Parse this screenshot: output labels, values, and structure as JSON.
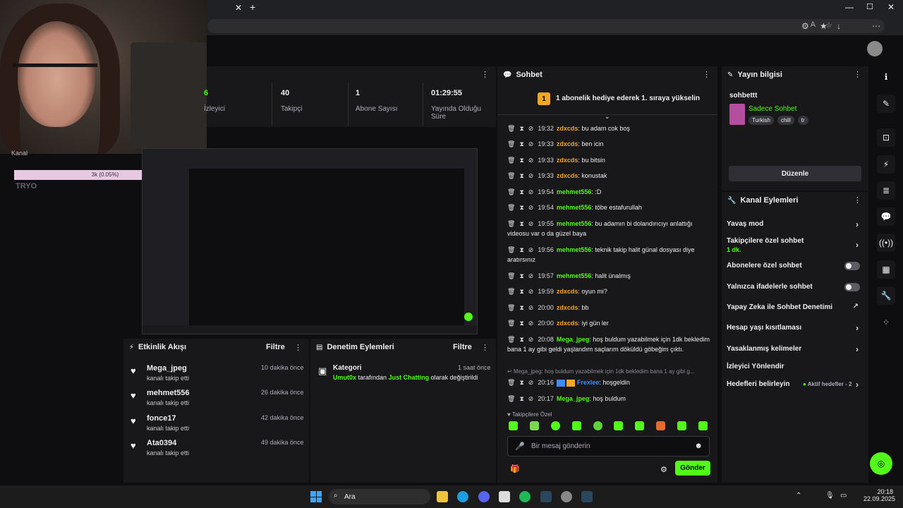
{
  "stats": [
    {
      "num": "6",
      "label": "İzleyici"
    },
    {
      "num": "40",
      "label": "Takipçi"
    },
    {
      "num": "1",
      "label": "Abone Sayısı"
    },
    {
      "num": "01:29:55",
      "label": "Yayında Olduğu Süre"
    }
  ],
  "overlay": {
    "bar_text": "3k (0.05%)",
    "name": "TRYO",
    "header": "Kanal"
  },
  "activity": {
    "title": "Etkinlik Akışı",
    "filter": "Filtre",
    "items": [
      {
        "name": "Mega_jpeg",
        "sub": "kanalı takip etti",
        "when": "10 dakika önce"
      },
      {
        "name": "mehmet556",
        "sub": "kanalı takip etti",
        "when": "26 dakika önce"
      },
      {
        "name": "fonce17",
        "sub": "kanalı takip etti",
        "when": "42 dakika önce"
      },
      {
        "name": "Ata0394",
        "sub": "kanalı takip etti",
        "when": "49 dakika önce"
      }
    ]
  },
  "moderation": {
    "title": "Denetim Eylemleri",
    "filter": "Filtre",
    "item": {
      "title": "Kategori",
      "when": "1 saat önce",
      "user": "Umut0x",
      "pre": " tarafından ",
      "cat": "Just Chatting",
      "post": " olarak değiştirildi"
    }
  },
  "chat": {
    "title": "Sohbet",
    "banner": "1 abonelik hediye ederek 1. sıraya yükselin",
    "messages": [
      {
        "time": "19:32",
        "user": "zdxcds",
        "color": "orange",
        "text": ": bu adam cok boş"
      },
      {
        "time": "19:33",
        "user": "zdxcds",
        "color": "orange",
        "text": ": ben icin"
      },
      {
        "time": "19:33",
        "user": "zdxcds",
        "color": "orange",
        "text": ": bu bitsin"
      },
      {
        "time": "19:33",
        "user": "zdxcds",
        "color": "orange",
        "text": ": konustak"
      },
      {
        "time": "19:54",
        "user": "mehmet556",
        "color": "green",
        "text": ": :D"
      },
      {
        "time": "19:54",
        "user": "mehmet556",
        "color": "green",
        "text": ": töbe estafurullah"
      },
      {
        "time": "19:55",
        "user": "mehmet556",
        "color": "green",
        "text": ": bu adamın bi dolandırıcıyı anlattığı videosu var o da güzel baya"
      },
      {
        "time": "19:56",
        "user": "mehmet556",
        "color": "green",
        "text": ": teknik takip halit günal dosyası diye aratırsınız"
      },
      {
        "time": "19:57",
        "user": "mehmet556",
        "color": "green",
        "text": ": halit ünalmış"
      },
      {
        "time": "19:59",
        "user": "zdxcds",
        "color": "orange",
        "text": ": oyun mi?"
      },
      {
        "time": "20:00",
        "user": "zdxcds",
        "color": "orange",
        "text": ": bb"
      },
      {
        "time": "20:00",
        "user": "zdxcds",
        "color": "orange",
        "text": ": iyi gün ler"
      },
      {
        "time": "20:08",
        "user": "Mega_jpeg",
        "color": "green",
        "text": ": hoş buldum yazabilmek için 1dk bekledim bana 1 ay gibi geldi yaşlandım saçlarım döküldü göbeğim çıktı."
      },
      {
        "time": "20:16",
        "user": "Frexlee",
        "color": "blue",
        "text": ": hoşgeldin"
      },
      {
        "time": "20:17",
        "user": "Mega_jpeg",
        "color": "green",
        "text": ": hoş buldum"
      }
    ],
    "reply": "Mega_jpeg: hoş buldum yazabilmek için 1dk bekledim bana 1 ay gibi g...",
    "followers_only": "Takipçilere Özel",
    "placeholder": "Bir mesaj gönderin",
    "send": "Gönder"
  },
  "info": {
    "title": "Yayın bilgisi",
    "stream_title": "sohbettt",
    "category": "Sadece Sohbet",
    "tags": [
      "Turkish",
      "chill",
      "tr"
    ],
    "edit": "Düzenle"
  },
  "actions": {
    "title": "Kanal Eylemleri",
    "slow": "Yavaş mod",
    "followers": "Takipçilere özel sohbet",
    "followers_sub": "1 dk.",
    "subs": "Abonelere özel sohbet",
    "emotes": "Yalnızca ifadelerle sohbet",
    "ai": "Yapay Zeka ile Sohbet Denetimi",
    "age": "Hesap yaşı kısıtlaması",
    "banned": "Yasaklanmış kelimeler",
    "redirect": "İzleyici Yönlendir",
    "goals": "Hedefleri belirleyin",
    "goals_active": "Aktif hedefler - 2"
  },
  "taskbar": {
    "search": "Ara",
    "time": "20:18",
    "date": "22.09.2025"
  },
  "colors": {
    "accent": "#53fc18",
    "bg": "#0e0e10",
    "panel": "#18181b"
  }
}
